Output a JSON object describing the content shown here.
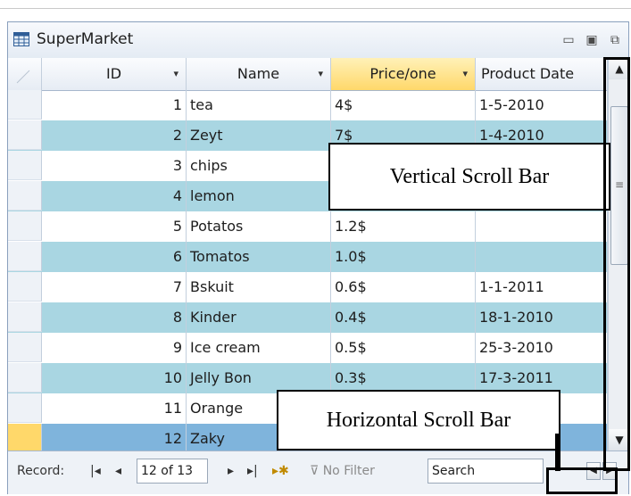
{
  "window": {
    "title": "SuperMarket",
    "minimize": "▭",
    "restore": "▣",
    "close": "⧉"
  },
  "columns": [
    {
      "label": "ID",
      "dropdown": "▾"
    },
    {
      "label": "Name",
      "dropdown": "▾"
    },
    {
      "label": "Price/one",
      "dropdown": "▾"
    },
    {
      "label": "Product Date"
    }
  ],
  "rows": [
    {
      "id": "1",
      "name": "tea",
      "price": "4$",
      "date": "1-5-2010"
    },
    {
      "id": "2",
      "name": "Zeyt",
      "price": "7$",
      "date": "1-4-2010"
    },
    {
      "id": "3",
      "name": "chips",
      "price": "",
      "date": ""
    },
    {
      "id": "4",
      "name": "lemon",
      "price": "",
      "date": ""
    },
    {
      "id": "5",
      "name": "Potatos",
      "price": "1.2$",
      "date": ""
    },
    {
      "id": "6",
      "name": "Tomatos",
      "price": "1.0$",
      "date": ""
    },
    {
      "id": "7",
      "name": "Bskuit",
      "price": "0.6$",
      "date": "1-1-2011"
    },
    {
      "id": "8",
      "name": "Kinder",
      "price": "0.4$",
      "date": "18-1-2010"
    },
    {
      "id": "9",
      "name": "Ice cream",
      "price": "0.5$",
      "date": "25-3-2010"
    },
    {
      "id": "10",
      "name": "Jelly Bon",
      "price": "0.3$",
      "date": "17-3-2011"
    },
    {
      "id": "11",
      "name": "Orange",
      "price": "",
      "date": ""
    },
    {
      "id": "12",
      "name": "Zaky",
      "price": "",
      "date": ""
    }
  ],
  "nav": {
    "record_label": "Record:",
    "first": "|◂",
    "prev": "◂",
    "current": "12 of 13",
    "next": "▸",
    "last": "▸|",
    "new": "▸✱",
    "filter": "No Filter",
    "search": "Search"
  },
  "scrollbar": {
    "up": "▲",
    "down": "▼",
    "grip": "≡",
    "left": "◀",
    "right": "▶"
  },
  "annotations": {
    "vertical": "Vertical  Scroll Bar",
    "horizontal": "Horizontal Scroll Bar"
  },
  "colors": {
    "alt_row": "#a9d6e2",
    "current_row": "#7fb4dc",
    "selected_header": "#ffd86a"
  }
}
